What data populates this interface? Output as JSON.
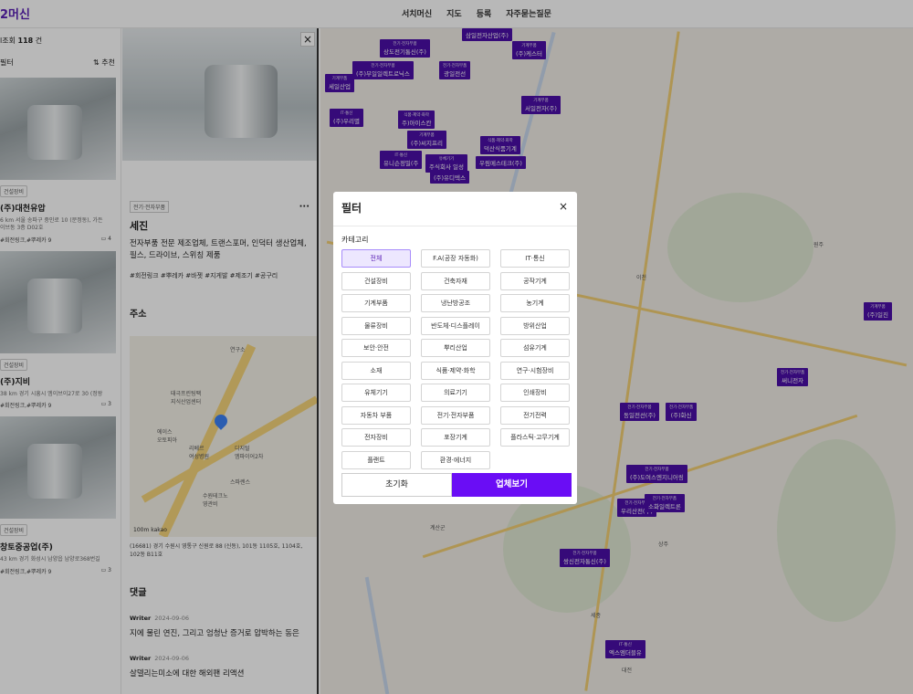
{
  "header": {
    "logo": "2머신",
    "nav": [
      "서치머신",
      "지도",
      "등록",
      "자주묻는질문"
    ]
  },
  "list": {
    "count_prefix": "l조회",
    "count": "118",
    "count_suffix": "건",
    "filter_label": "필터",
    "sort_label": "추천",
    "cards": [
      {
        "category": "건설장비",
        "name": "(주)대천유압",
        "address": "6 km 서울 송파구 중인로 10 (문정동), 가든\n이브동 3층 D02호",
        "tags": "#회전링크,#뿌레카 9",
        "comments": "4"
      },
      {
        "category": "건설장비",
        "name": "(주)지비",
        "address": "38 km 경기 시흥시 엠이브이27로 30 (정왕",
        "tags": "#회전링크,#뿌레카 9",
        "comments": "3"
      },
      {
        "category": "건설장비",
        "name": "창토중공업(주)",
        "address": "43 km 경기 화성시 남양읍 남양로368번길",
        "tags": "#회전링크,#뿌레카 9",
        "comments": "3"
      }
    ]
  },
  "detail": {
    "category": "전기·전자부품",
    "title": "세진",
    "description": "전자부품 전문 제조업체, 트랜스포머, 인덕터 생산업체, 필스, 드라이브, 스위칭 제품",
    "tags": "#회전링크 #뿌레카 #바젯 #지게발 #제조기 #공구리",
    "address_title": "주소",
    "address": "(16681) 경기 수원시 영통구 신원로 88 (신동), 101동 1105호, 1104호, 102동 B11호",
    "map_scale": "100m",
    "map_brand": "kakao",
    "map_labels": [
      "연구소",
      "태극프린팅팩\n지식산업센터",
      "에이스\n오토피아",
      "리베르\n여성병원",
      "디지털\n엠파이어2차",
      "스파렌스",
      "수원테크노\n영관비"
    ],
    "comments_title": "댓글",
    "comments": [
      {
        "writer": "Writer",
        "date": "2024-09-06",
        "text": "지에 물린 연진, 그리고 엄청난 증거로 압박하는 동은"
      },
      {
        "writer": "Writer",
        "date": "2024-09-06",
        "text": "살델리는미소에 대한 해외팬 리액션"
      }
    ]
  },
  "map": {
    "markers": [
      {
        "sub": "",
        "name": "삼일전자산업(주)"
      },
      {
        "sub": "전기·전자부품",
        "name": "상도전기통신(주)"
      },
      {
        "sub": "기계부품",
        "name": "(주)케스터"
      },
      {
        "sub": "전기·전자부품",
        "name": "(주)부일일렉트로닉스"
      },
      {
        "sub": "전기·전자부품",
        "name": "광일전선"
      },
      {
        "sub": "기계부품",
        "name": "세일산업"
      },
      {
        "sub": "기계부품",
        "name": "서일전자(주)"
      },
      {
        "sub": "IT·통신",
        "name": "(주)우리별"
      },
      {
        "sub": "식품·제약·화학",
        "name": "주)아이스칸"
      },
      {
        "sub": "기계부품",
        "name": "(주)씨지프리"
      },
      {
        "sub": "식품·제약·화학",
        "name": "덕산식품기계"
      },
      {
        "sub": "IT·통신",
        "name": "유니슨정밀(주"
      },
      {
        "sub": "유체기기",
        "name": "주식회사 일성"
      },
      {
        "sub": "",
        "name": "우림메스테크(주)"
      },
      {
        "sub": "",
        "name": "(주)유디텍스"
      },
      {
        "sub": "기계부품",
        "name": "(주)일진"
      },
      {
        "sub": "전기·전자부품",
        "name": "써니전자"
      },
      {
        "sub": "전기·전자부품",
        "name": "동일전선(주)"
      },
      {
        "sub": "전기·전자부품",
        "name": "(주)화신"
      },
      {
        "sub": "전기·전자부품",
        "name": "(주)도여스엔지니어링"
      },
      {
        "sub": "전기·전자부품",
        "name": "우리산전(주)"
      },
      {
        "sub": "전기·전자부품",
        "name": "소화일렉트론"
      },
      {
        "sub": "전기·전자부품",
        "name": "쌍신전자통신(주)"
      },
      {
        "sub": "IT·통신",
        "name": "엑스엠더블유"
      }
    ],
    "cities": [
      "이천",
      "원주",
      "세종",
      "대전",
      "상주",
      "계산군"
    ]
  },
  "filter_modal": {
    "title": "필터",
    "close": "×",
    "section": "카테고리",
    "categories": [
      "전체",
      "F.A(공장 자동화)",
      "IT·통신",
      "건설장비",
      "건축자재",
      "공작기계",
      "기계부품",
      "냉난방공조",
      "농기계",
      "물류장비",
      "반도체·디스플레이",
      "방위산업",
      "보안·안전",
      "뿌리산업",
      "섬유기계",
      "소재",
      "식품·제약·화학",
      "연구·시험장비",
      "유체기기",
      "의료기기",
      "인쇄장비",
      "자동차 부품",
      "전기·전자부품",
      "전기전력",
      "전자장비",
      "포장기계",
      "플라스틱·고무기계",
      "플랜트",
      "환경·에너지"
    ],
    "selected": "전체",
    "reset_label": "초기화",
    "apply_label": "업체보기"
  },
  "colors": {
    "brand": "#6a0df5",
    "marker": "#4b0fa8",
    "chip_active_bg": "#ede7fe"
  }
}
